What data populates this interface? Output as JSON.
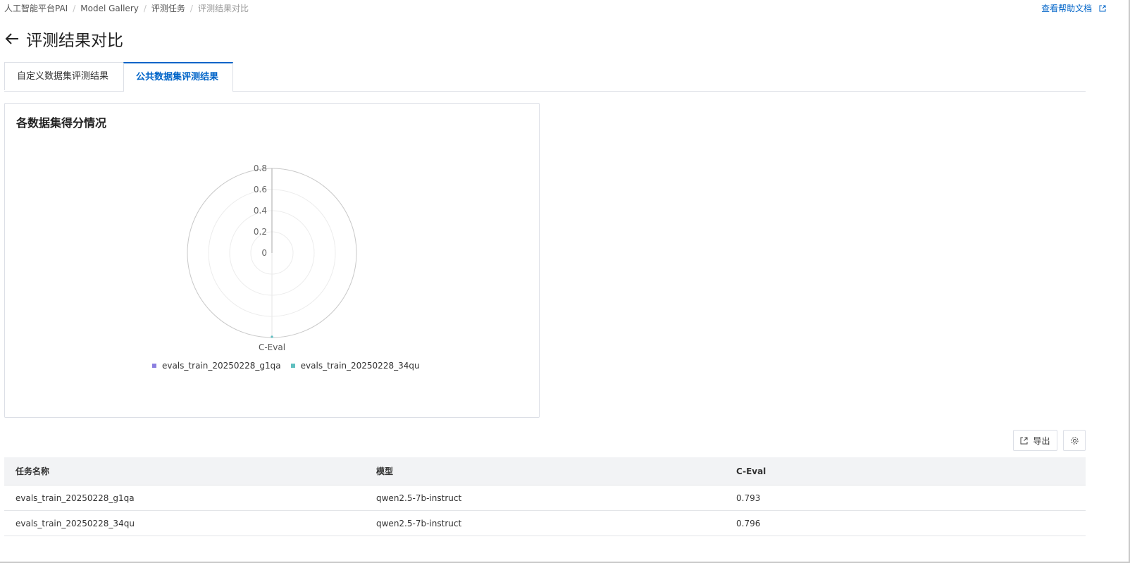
{
  "breadcrumb": {
    "items": [
      "人工智能平台PAI",
      "Model Gallery",
      "评测任务"
    ],
    "current": "评测结果对比",
    "separator": "/"
  },
  "help_link": "查看帮助文档",
  "page_title": "评测结果对比",
  "tabs": [
    {
      "label": "自定义数据集评测结果",
      "active": false
    },
    {
      "label": "公共数据集评测结果",
      "active": true
    }
  ],
  "chart_card": {
    "title": "各数据集得分情况"
  },
  "chart_data": {
    "type": "radar",
    "indicators": [
      "C-Eval"
    ],
    "radial_ticks": [
      "0",
      "0.2",
      "0.4",
      "0.6",
      "0.8"
    ],
    "range": [
      0,
      0.8
    ],
    "series": [
      {
        "name": "evals_train_20250228_g1qa",
        "values": [
          0.793
        ],
        "color": "#8b7fe0"
      },
      {
        "name": "evals_train_20250228_34qu",
        "values": [
          0.796
        ],
        "color": "#5fbfbf"
      }
    ],
    "legend_position": "bottom"
  },
  "toolbar": {
    "export_label": "导出",
    "icons": [
      "export-icon",
      "settings-icon"
    ]
  },
  "table": {
    "columns": [
      "任务名称",
      "模型",
      "C-Eval"
    ],
    "rows": [
      [
        "evals_train_20250228_g1qa",
        "qwen2.5-7b-instruct",
        "0.793"
      ],
      [
        "evals_train_20250228_34qu",
        "qwen2.5-7b-instruct",
        "0.796"
      ]
    ]
  },
  "colors": {
    "accent": "#0064c8",
    "border": "#dcdfe6",
    "table_header_bg": "#f2f3f5"
  }
}
